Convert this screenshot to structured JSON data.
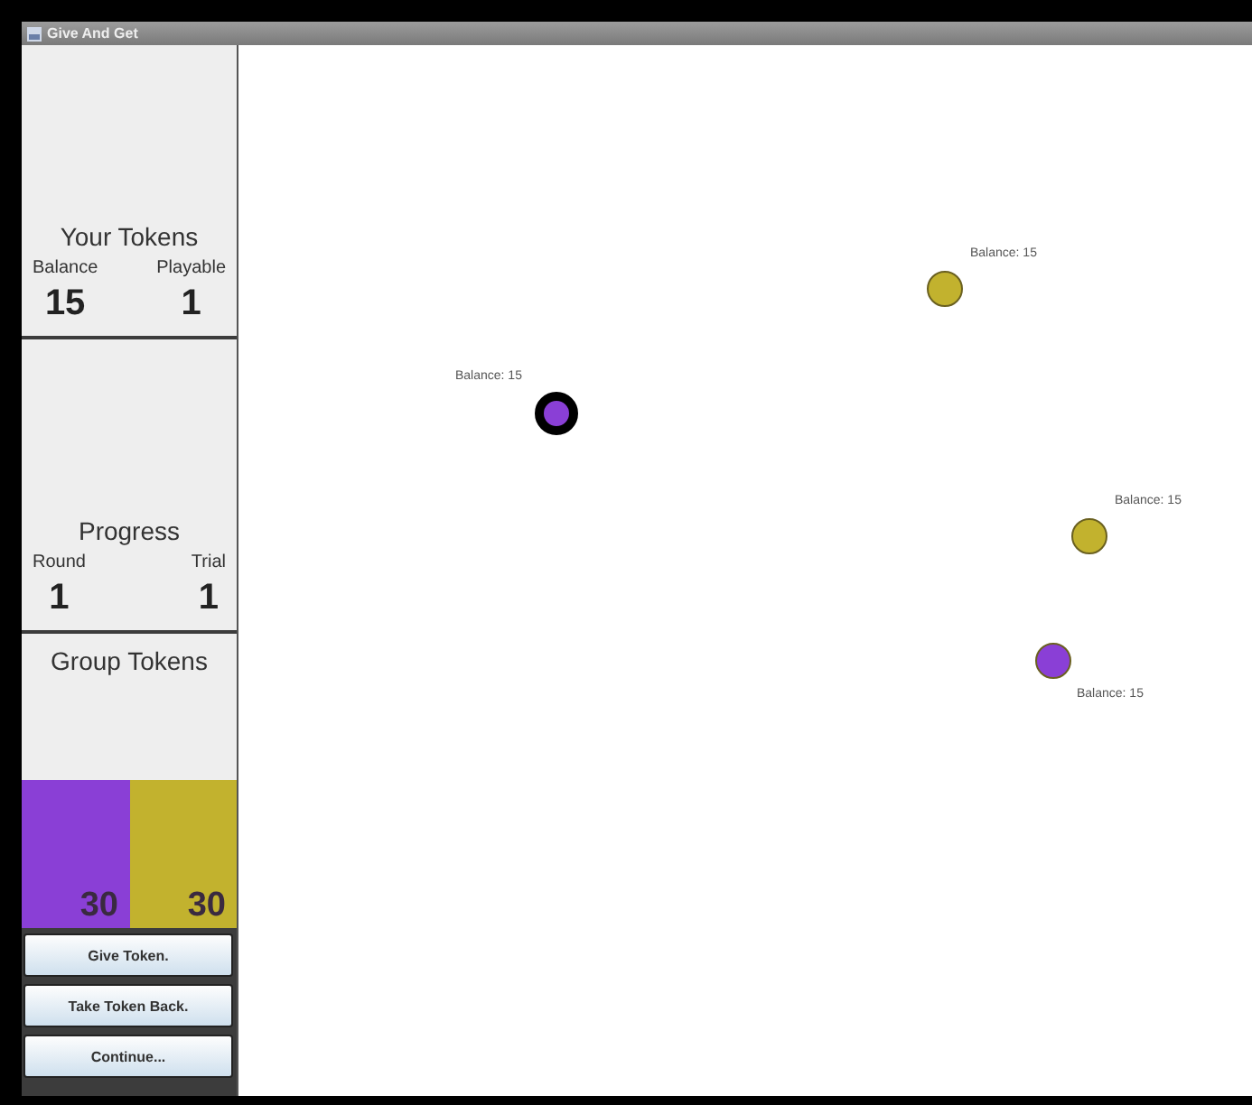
{
  "window": {
    "title": "Give And Get"
  },
  "your_tokens": {
    "title": "Your Tokens",
    "stats": [
      {
        "label": "Balance",
        "value": "15"
      },
      {
        "label": "Playable",
        "value": "1"
      }
    ]
  },
  "progress": {
    "title": "Progress",
    "stats": [
      {
        "label": "Round",
        "value": "1"
      },
      {
        "label": "Trial",
        "value": "1"
      }
    ]
  },
  "group_tokens": {
    "title": "Group Tokens",
    "groups": [
      {
        "value": "30",
        "color": "#8a3fd6"
      },
      {
        "value": "30",
        "color": "#c2b22e"
      }
    ]
  },
  "buttons": [
    "Give Token.",
    "Take Token Back.",
    "Continue..."
  ],
  "players": [
    {
      "label": "Balance: 15",
      "color": "#c2b22e",
      "selected": false
    },
    {
      "label": "Balance: 15",
      "color": "#8a3fd6",
      "selected": true
    },
    {
      "label": "Balance: 15",
      "color": "#c2b22e",
      "selected": false
    },
    {
      "label": "Balance: 15",
      "color": "#8a3fd6",
      "selected": false
    }
  ]
}
